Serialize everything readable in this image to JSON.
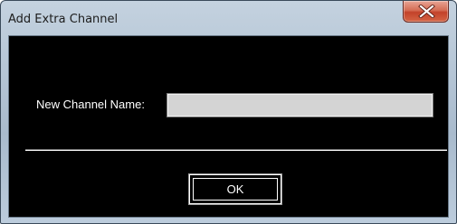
{
  "window": {
    "title": "Add Extra Channel",
    "close_icon": "close-x-icon"
  },
  "form": {
    "channel_name_label": "New Channel Name:",
    "channel_name_value": "",
    "channel_name_placeholder": ""
  },
  "buttons": {
    "ok_label": "OK"
  },
  "colors": {
    "client_background": "#000000",
    "text": "#ffffff",
    "input_background": "#d4d4d4",
    "close_button_red": "#c3422a",
    "title_bar": "#b6c6d6"
  }
}
